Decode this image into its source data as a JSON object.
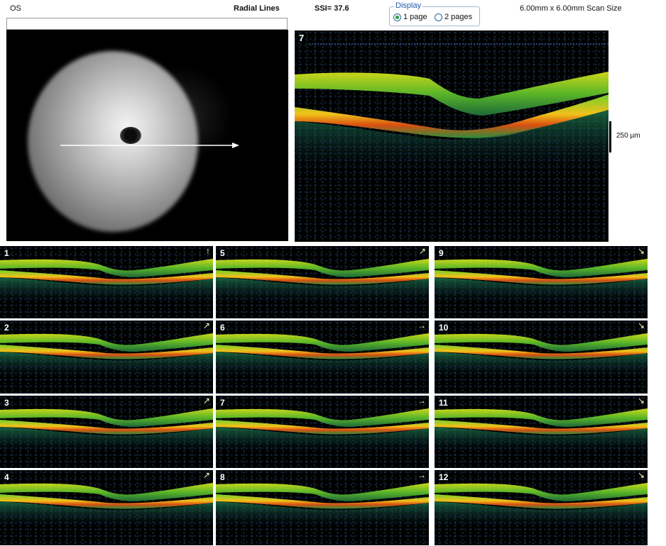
{
  "header": {
    "eye": "OS",
    "scan_pattern": "Radial Lines",
    "ssi": "SSI= 37.6",
    "display_legend": "Display",
    "display_options": [
      "1 page",
      "2 pages"
    ],
    "display_selected": "1 page",
    "scan_size": "6.00mm x 6.00mm Scan Size"
  },
  "main_scan": {
    "number": "7"
  },
  "scale": {
    "label": "250 µm"
  },
  "thumbnails": [
    {
      "number": "1",
      "arrow": "↑"
    },
    {
      "number": "2",
      "arrow": "↗"
    },
    {
      "number": "3",
      "arrow": "↗"
    },
    {
      "number": "4",
      "arrow": "↗"
    },
    {
      "number": "5",
      "arrow": "↗"
    },
    {
      "number": "6",
      "arrow": "→"
    },
    {
      "number": "7",
      "arrow": "→"
    },
    {
      "number": "8",
      "arrow": "→"
    },
    {
      "number": "9",
      "arrow": "↘"
    },
    {
      "number": "10",
      "arrow": "↘"
    },
    {
      "number": "11",
      "arrow": "↘"
    },
    {
      "number": "12",
      "arrow": "↘"
    }
  ]
}
